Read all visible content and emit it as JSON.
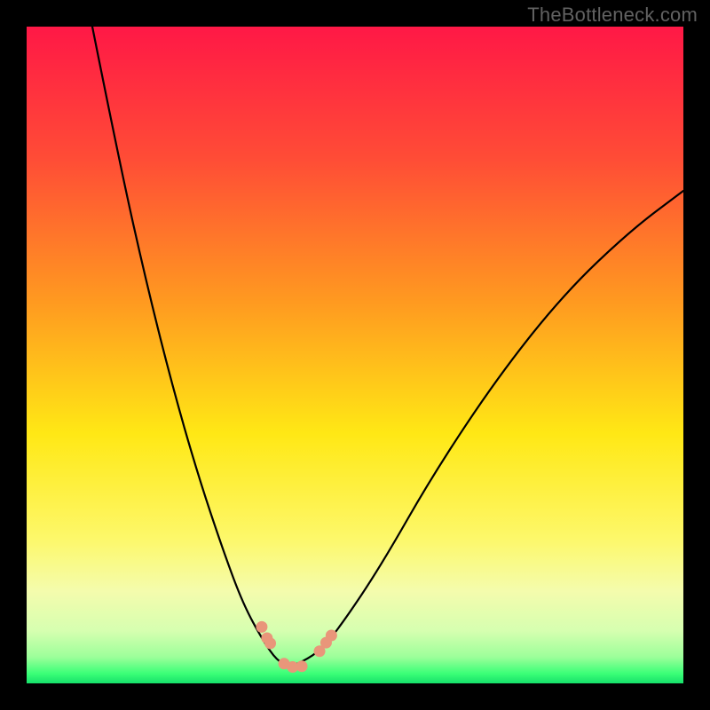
{
  "watermark_text": "TheBottleneck.com",
  "colors": {
    "page_bg": "#000000",
    "watermark": "#616161",
    "curve_stroke": "#000000",
    "marker_fill": "#e9967a",
    "gradient_stops": [
      {
        "offset": 0.0,
        "color": "#ff1846"
      },
      {
        "offset": 0.2,
        "color": "#ff4c36"
      },
      {
        "offset": 0.42,
        "color": "#ff9a20"
      },
      {
        "offset": 0.62,
        "color": "#ffe815"
      },
      {
        "offset": 0.78,
        "color": "#fdf86a"
      },
      {
        "offset": 0.86,
        "color": "#f4fcad"
      },
      {
        "offset": 0.92,
        "color": "#d6ffb0"
      },
      {
        "offset": 0.96,
        "color": "#9cff9a"
      },
      {
        "offset": 0.985,
        "color": "#3bff77"
      },
      {
        "offset": 1.0,
        "color": "#16e06a"
      }
    ]
  },
  "chart_data": {
    "type": "line",
    "title": "",
    "xlabel": "",
    "ylabel": "",
    "xlim": [
      0,
      1
    ],
    "ylim": [
      0,
      1
    ],
    "note": "x/y are normalized fractions of the plot area (0..1, origin at top-left). The two branches form a V-shaped bottleneck curve.",
    "series": [
      {
        "name": "left_branch",
        "x": [
          0.1,
          0.14,
          0.18,
          0.22,
          0.26,
          0.3,
          0.33,
          0.36,
          0.381,
          0.4
        ],
        "y": [
          0.0,
          0.2,
          0.38,
          0.54,
          0.68,
          0.8,
          0.88,
          0.935,
          0.965,
          0.975
        ]
      },
      {
        "name": "right_branch",
        "x": [
          0.4,
          0.44,
          0.48,
          0.54,
          0.62,
          0.72,
          0.82,
          0.92,
          1.0
        ],
        "y": [
          0.975,
          0.96,
          0.91,
          0.82,
          0.68,
          0.53,
          0.405,
          0.31,
          0.25
        ]
      }
    ],
    "markers": {
      "name": "highlighted_points",
      "comment": "salmon dots near the valley",
      "x": [
        0.358,
        0.366,
        0.371,
        0.392,
        0.405,
        0.419,
        0.446,
        0.456,
        0.464
      ],
      "y": [
        0.914,
        0.931,
        0.939,
        0.97,
        0.975,
        0.974,
        0.951,
        0.938,
        0.927
      ]
    }
  }
}
